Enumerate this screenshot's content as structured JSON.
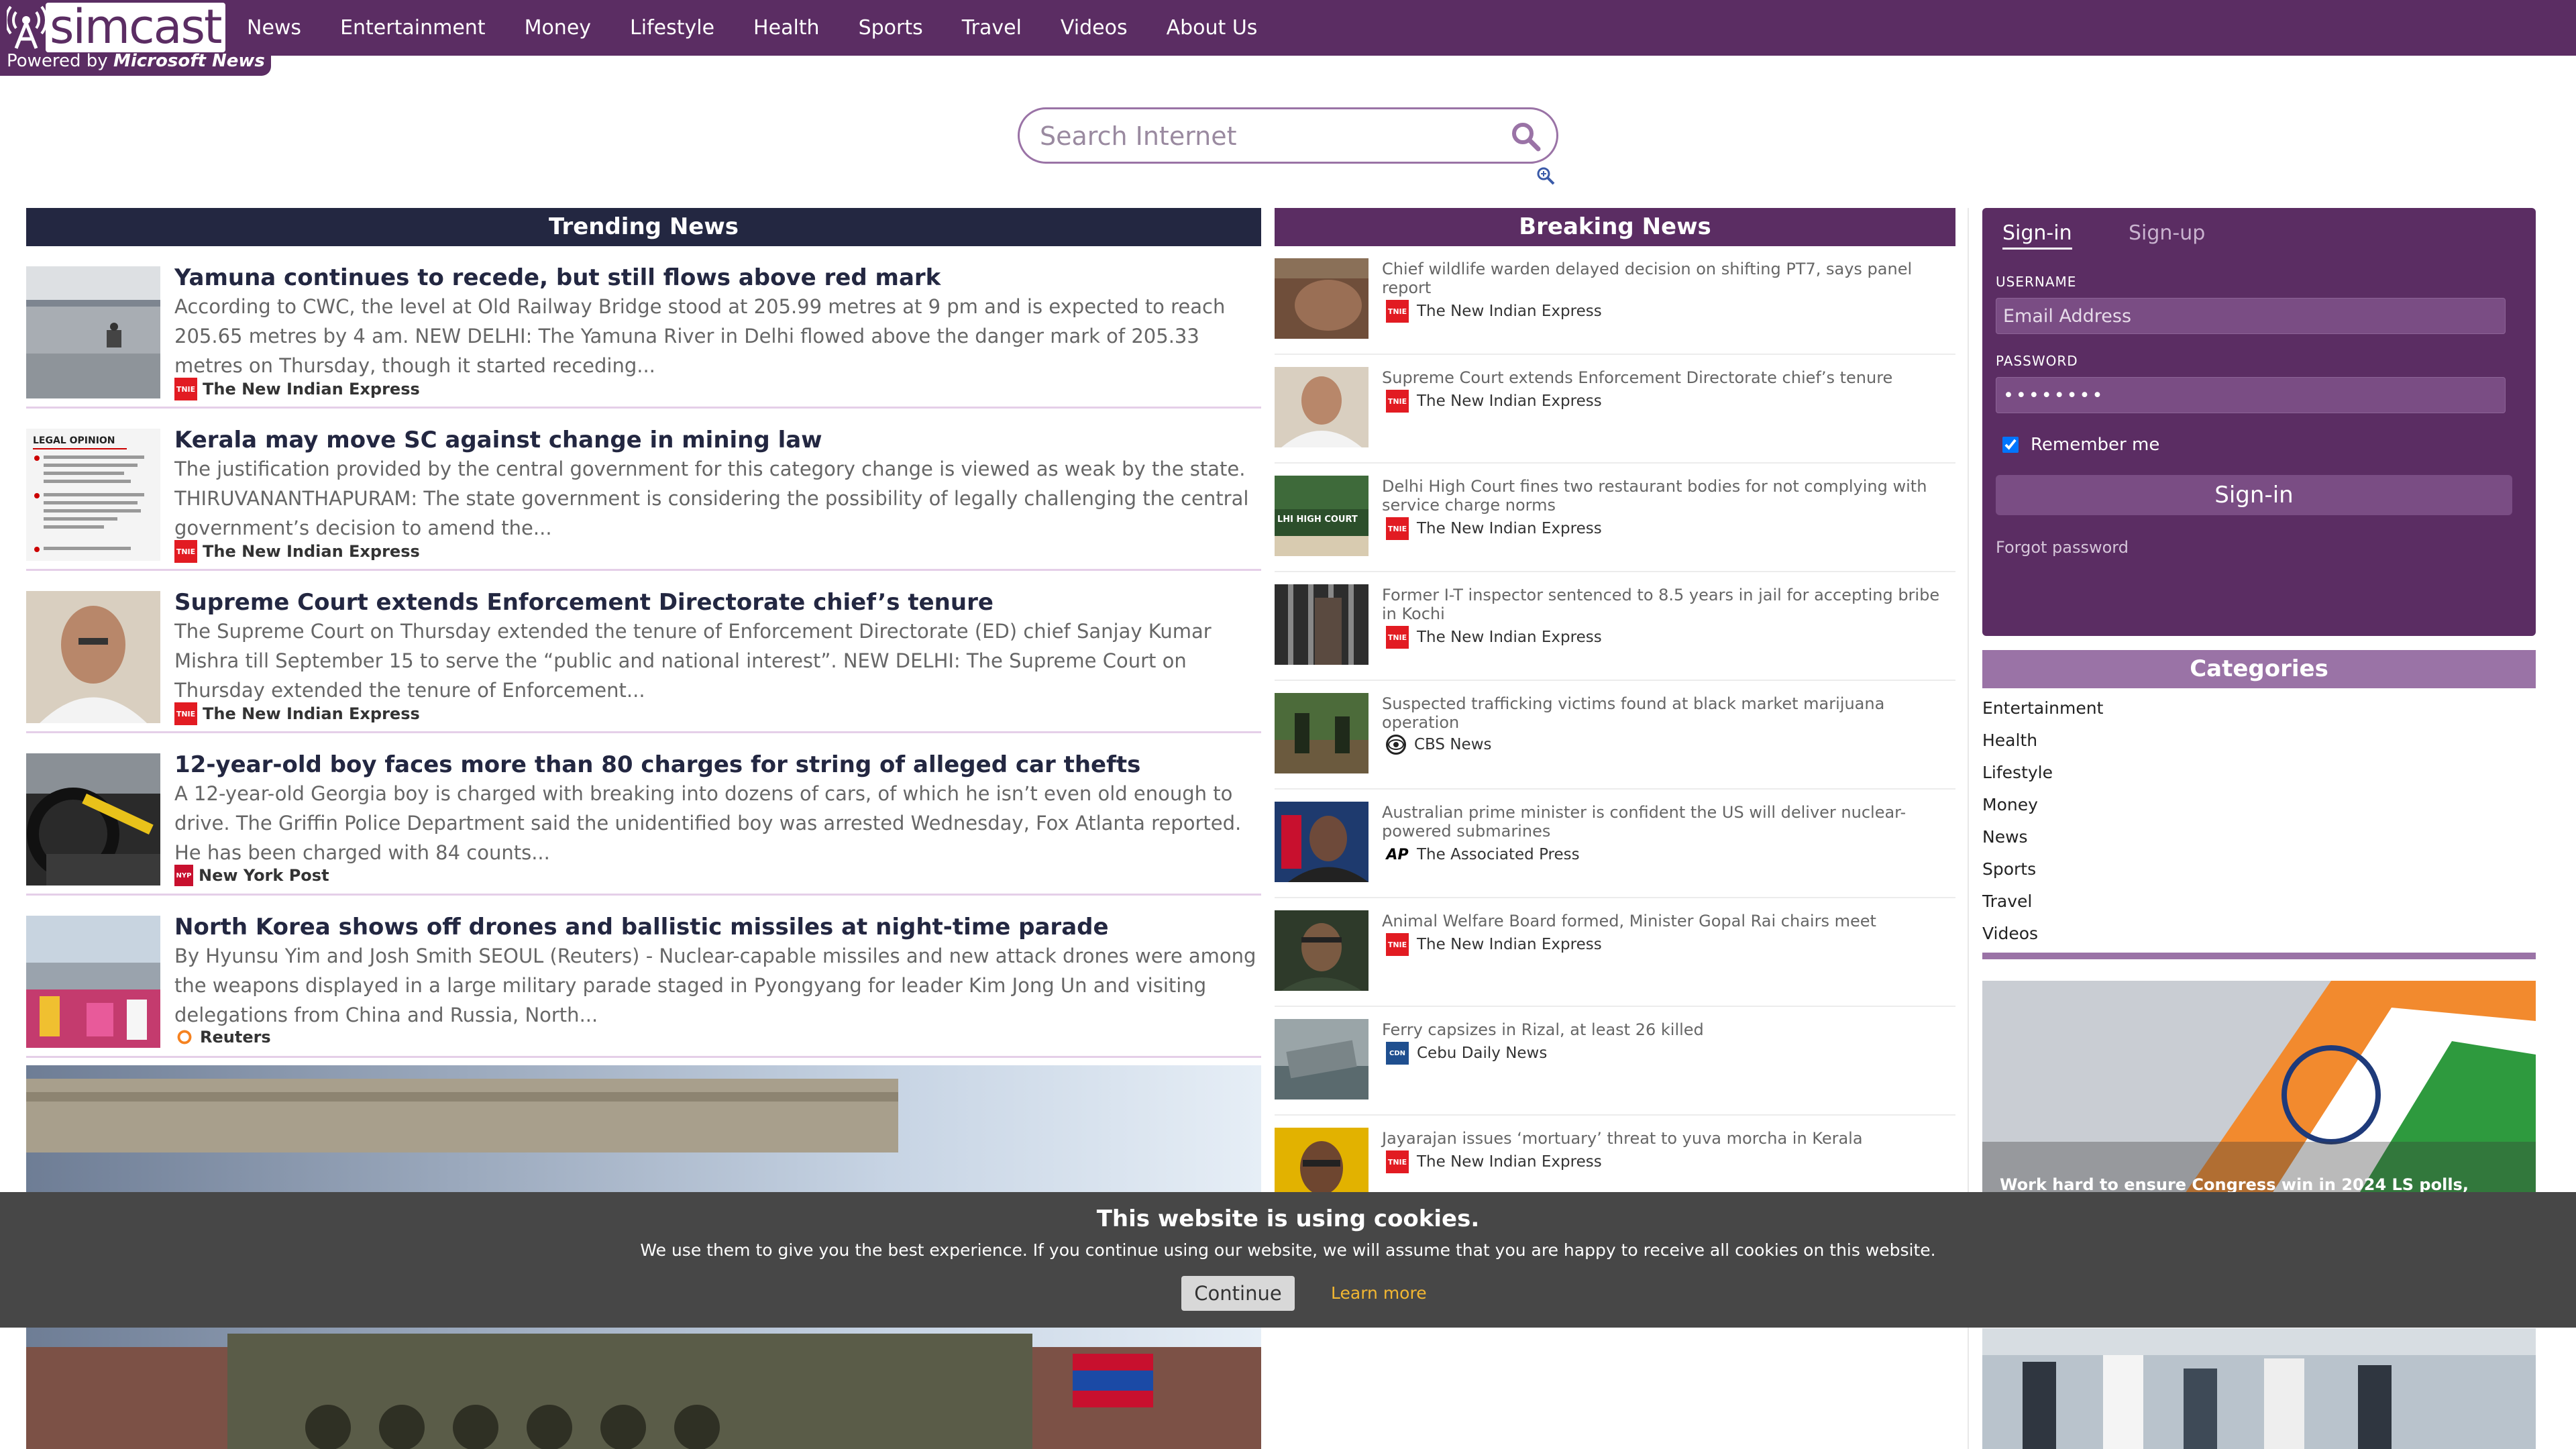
{
  "brand": {
    "logo_text": "simcast",
    "powered_prefix": "Powered by",
    "powered_by": "Microsoft News",
    "color": "#5b2d63"
  },
  "nav": {
    "items": [
      {
        "label": "News"
      },
      {
        "label": "Entertainment"
      },
      {
        "label": "Money"
      },
      {
        "label": "Lifestyle"
      },
      {
        "label": "Health"
      },
      {
        "label": "Sports"
      },
      {
        "label": "Travel"
      },
      {
        "label": "Videos"
      },
      {
        "label": "About Us"
      }
    ]
  },
  "search": {
    "placeholder": "Search Internet",
    "value": "",
    "icon": "search-icon",
    "zoom_icon": "zoom-in-icon"
  },
  "trending": {
    "title": "Trending News",
    "items": [
      {
        "title": "Yamuna continues to recede, but still flows above red mark",
        "desc": "According to CWC, the level at Old Railway Bridge stood at 205.99 metres at 9 pm and is expected to reach 205.65 metres by 4 am. NEW DELHI: The Yamuna River in Delhi flowed above the danger mark of 205.33 metres on Thursday, though it started receding...",
        "source": "The New Indian Express",
        "badge": "TNIE"
      },
      {
        "title": "Kerala may move SC against change in mining law",
        "desc": "The justification provided by the central government for this category change is viewed as weak by the state. THIRUVANANTHAPURAM: The state government is considering the possibility of legally challenging the central government’s decision to amend the...",
        "source": "The New Indian Express",
        "badge": "TNIE",
        "thumb_text": "LEGAL OPINION"
      },
      {
        "title": "Supreme Court extends Enforcement Directorate chief’s tenure",
        "desc": "The Supreme Court on Thursday extended the tenure of Enforcement Directorate (ED) chief Sanjay Kumar Mishra till September 15 to serve the “public and national interest”. NEW DELHI: The Supreme Court on Thursday extended the tenure of Enforcement...",
        "source": "The New Indian Express",
        "badge": "TNIE"
      },
      {
        "title": "12-year-old boy faces more than 80 charges for string of alleged car thefts",
        "desc": "A 12-year-old Georgia boy is charged with breaking into dozens of cars, of which he isn’t even old enough to drive. The Griffin Police Department said the unidentified boy was arrested Wednesday, Fox Atlanta reported. He has been charged with 84 counts...",
        "source": "New York Post",
        "badge": "NYP"
      },
      {
        "title": "North Korea shows off drones and ballistic missiles at night-time parade",
        "desc": "By Hyunsu Yim and Josh Smith SEOUL (Reuters) - Nuclear-capable missiles and new attack drones were among the weapons displayed in a large military parade staged in Pyongyang for leader Kim Jong Un and visiting delegations from China and Russia, North...",
        "source": "Reuters",
        "badge": "R"
      }
    ]
  },
  "breaking": {
    "title": "Breaking News",
    "items": [
      {
        "title": "Chief wildlife warden delayed decision on shifting PT7, says panel report",
        "source": "The New Indian Express",
        "badge": "TNIE"
      },
      {
        "title": "Supreme Court extends Enforcement Directorate chief’s tenure",
        "source": "The New Indian Express",
        "badge": "TNIE"
      },
      {
        "title": "Delhi High Court fines two restaurant bodies for not complying with service charge norms",
        "source": "The New Indian Express",
        "badge": "TNIE",
        "thumb_text": "LHI HIGH COURT"
      },
      {
        "title": "Former I-T inspector sentenced to 8.5 years in jail for accepting bribe in Kochi",
        "source": "The New Indian Express",
        "badge": "TNIE"
      },
      {
        "title": "Suspected trafficking victims found at black market marijuana operation",
        "source": "CBS News",
        "badge": "CBS"
      },
      {
        "title": "Australian prime minister is confident the US will deliver nuclear-powered submarines",
        "source": "The Associated Press",
        "badge": "AP"
      },
      {
        "title": "Animal Welfare Board formed, Minister Gopal Rai chairs meet",
        "source": "The New Indian Express",
        "badge": "TNIE"
      },
      {
        "title": "Ferry capsizes in Rizal, at least 26 killed",
        "source": "Cebu Daily News",
        "badge": "CDN"
      },
      {
        "title": "Jayarajan issues ‘mortuary’ threat to yuva morcha in Kerala",
        "source": "The New Indian Express",
        "badge": "TNIE"
      }
    ]
  },
  "signin": {
    "tab_signin": "Sign-in",
    "tab_signup": "Sign-up",
    "username_label": "USERNAME",
    "username_placeholder": "Email Address",
    "password_label": "PASSWORD",
    "password_value": "••••••••",
    "remember_label": "Remember me",
    "remember_checked": true,
    "button_label": "Sign-in",
    "forgot_label": "Forgot password"
  },
  "categories": {
    "title": "Categories",
    "items": [
      {
        "label": "Entertainment"
      },
      {
        "label": "Health"
      },
      {
        "label": "Lifestyle"
      },
      {
        "label": "Money"
      },
      {
        "label": "News"
      },
      {
        "label": "Sports"
      },
      {
        "label": "Travel"
      },
      {
        "label": "Videos"
      }
    ]
  },
  "feature": {
    "caption": "Work hard to ensure Congress win in 2024 LS polls,"
  },
  "cookie": {
    "title": "This website is using cookies.",
    "text": "We use them to give you the best experience. If you continue using our website, we will assume that you are happy to receive all cookies on this website.",
    "button": "Continue",
    "link": "Learn more"
  }
}
